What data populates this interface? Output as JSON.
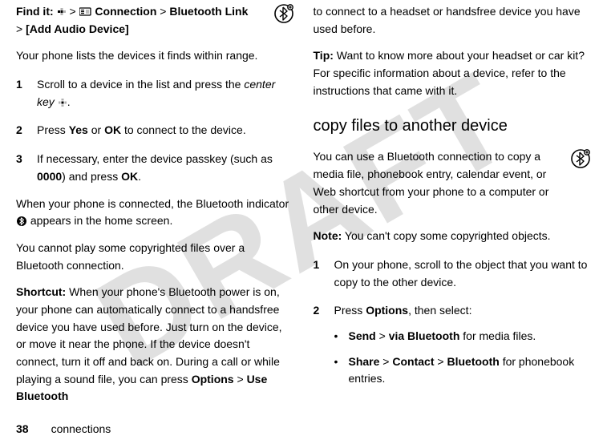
{
  "left": {
    "findit_label": "Find it:",
    "findit_path_1": "Connection",
    "findit_path_2": "Bluetooth Link",
    "findit_path_3": "[Add Audio Device]",
    "gt": ">",
    "intro": "Your phone lists the devices it finds within range.",
    "steps": [
      {
        "n": "1",
        "a": "Scroll to a device in the list and press the ",
        "b": "center key",
        "c": "."
      },
      {
        "n": "2",
        "a": "Press ",
        "b": "Yes",
        "c": " or ",
        "d": "OK",
        "e": " to connect to the device."
      },
      {
        "n": "3",
        "a": "If necessary, enter the device passkey (such as ",
        "b": "0000",
        "c": ") and press ",
        "d": "OK",
        "e": "."
      }
    ],
    "connected_a": "When your phone is connected, the Bluetooth indicator ",
    "connected_b": " appears in the home screen.",
    "copyright": "You cannot play some copyrighted files over a Bluetooth connection.",
    "shortcut_label": "Shortcut:",
    "shortcut_a": " When your phone's Bluetooth power is on, your phone can automatically connect to a handsfree device you have used before. Just turn on the device, or move it near the phone. If the device doesn't connect, turn it off and back on. During a call or while playing a sound file, you can press ",
    "shortcut_b": "Options",
    "shortcut_c": " > ",
    "shortcut_d": "Use Bluetooth"
  },
  "right": {
    "carry": "to connect to a headset or handsfree device you have used before.",
    "tip_label": "Tip:",
    "tip_body": " Want to know more about your headset or car kit? For specific information about a device, refer to the instructions that came with it.",
    "h2": "copy files to another device",
    "copy_a": "You can use a Bluetooth connection to copy a media file, phonebook entry, calendar event, or Web shortcut from your phone to a computer or other device.",
    "note_label": "Note:",
    "note_body": " You can't copy some copyrighted objects.",
    "steps": [
      {
        "n": "1",
        "a": "On your phone, scroll to the object that you want to copy to the other device."
      },
      {
        "n": "2",
        "a": "Press ",
        "b": "Options",
        "c": ", then select:"
      }
    ],
    "bullets": [
      {
        "a": "Send",
        "b": " > ",
        "c": "via Bluetooth",
        "d": " for media files."
      },
      {
        "a": "Share",
        "b": " > ",
        "c": "Contact",
        "d": " > ",
        "e": "Bluetooth",
        "f": " for phonebook entries."
      }
    ]
  },
  "footer": {
    "page": "38",
    "section": "connections"
  },
  "watermark": "DRAFT"
}
